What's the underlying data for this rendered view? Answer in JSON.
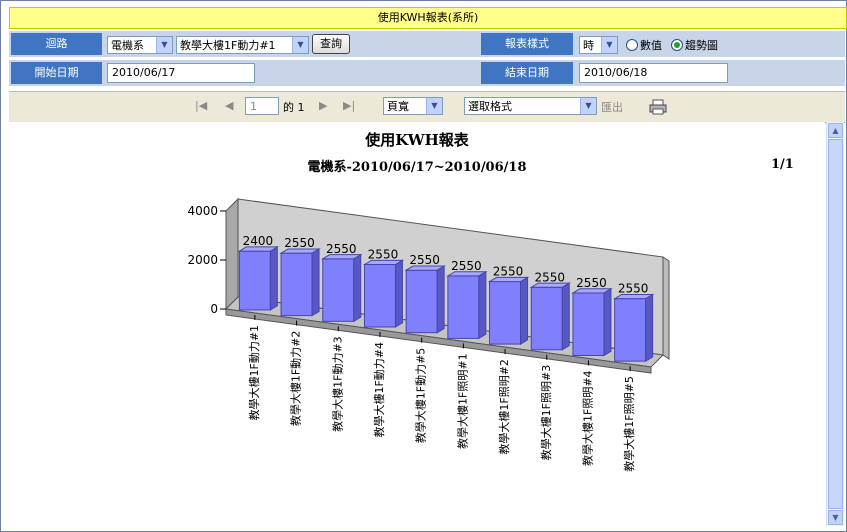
{
  "title": "使用KWH報表(系所)",
  "circuit": {
    "label": "迴路",
    "department": "電機系",
    "meter": "教學大樓1F動力#1",
    "query_button": "查詢"
  },
  "report_style": {
    "label": "報表樣式",
    "interval": "時",
    "option_values": "數值",
    "option_trend": "趨勢圖",
    "selected": "趨勢圖"
  },
  "start_date": {
    "label": "開始日期",
    "value": "2010/06/17"
  },
  "end_date": {
    "label": "結束日期",
    "value": "2010/06/18"
  },
  "toolbar": {
    "page_input": "1",
    "of_text": "的 1",
    "zoom": "頁寬",
    "export_format": "選取格式",
    "export_label": "匯出",
    "icons": [
      "first-page-icon",
      "prev-page-icon",
      "next-page-icon",
      "last-page-icon",
      "printer-icon"
    ]
  },
  "report": {
    "title": "使用KWH報表",
    "subtitle": "電機系-2010/06/17~2010/06/18",
    "page": "1/1"
  },
  "chart_data": {
    "type": "bar",
    "style": "3d",
    "categories": [
      "教學大樓1F動力#1",
      "教學大樓1F動力#2",
      "教學大樓1F動力#3",
      "教學大樓1F動力#4",
      "教學大樓1F動力#5",
      "教學大樓1F照明#1",
      "教學大樓1F照明#2",
      "教學大樓1F照明#3",
      "教學大樓1F照明#4",
      "教學大樓1F照明#5"
    ],
    "values": [
      2400,
      2550,
      2550,
      2550,
      2550,
      2550,
      2550,
      2550,
      2550,
      2550
    ],
    "yticks": [
      0,
      2000,
      4000
    ],
    "ylim": [
      0,
      4000
    ],
    "bar_color": "#8080ff"
  }
}
